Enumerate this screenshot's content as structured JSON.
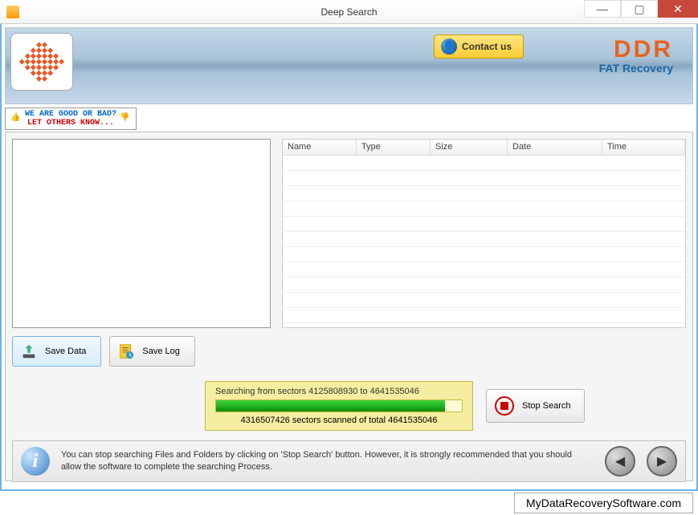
{
  "window": {
    "title": "Deep Search"
  },
  "header": {
    "contact_label": "Contact us",
    "brand_main": "DDR",
    "brand_sub": "FAT Recovery"
  },
  "feedback": {
    "line1": "WE ARE GOOD OR BAD?",
    "line2": "LET OTHERS KNOW..."
  },
  "columns": {
    "name": "Name",
    "type": "Type",
    "size": "Size",
    "date": "Date",
    "time": "Time"
  },
  "buttons": {
    "save_data": "Save Data",
    "save_log": "Save Log",
    "stop_search": "Stop Search"
  },
  "progress": {
    "searching_prefix": "Searching from sectors",
    "from_sector": "4125808930",
    "to_word": "to",
    "to_sector": "4641535046",
    "scanned": "4316507426",
    "scanned_mid": "sectors scanned of total",
    "total": "4641535046",
    "percent": 93
  },
  "info": {
    "text": "You can stop searching Files and Folders by clicking on 'Stop Search' button. However, it is strongly recommended that you should allow the software to complete the searching Process."
  },
  "footer": {
    "link": "MyDataRecoverySoftware.com"
  }
}
